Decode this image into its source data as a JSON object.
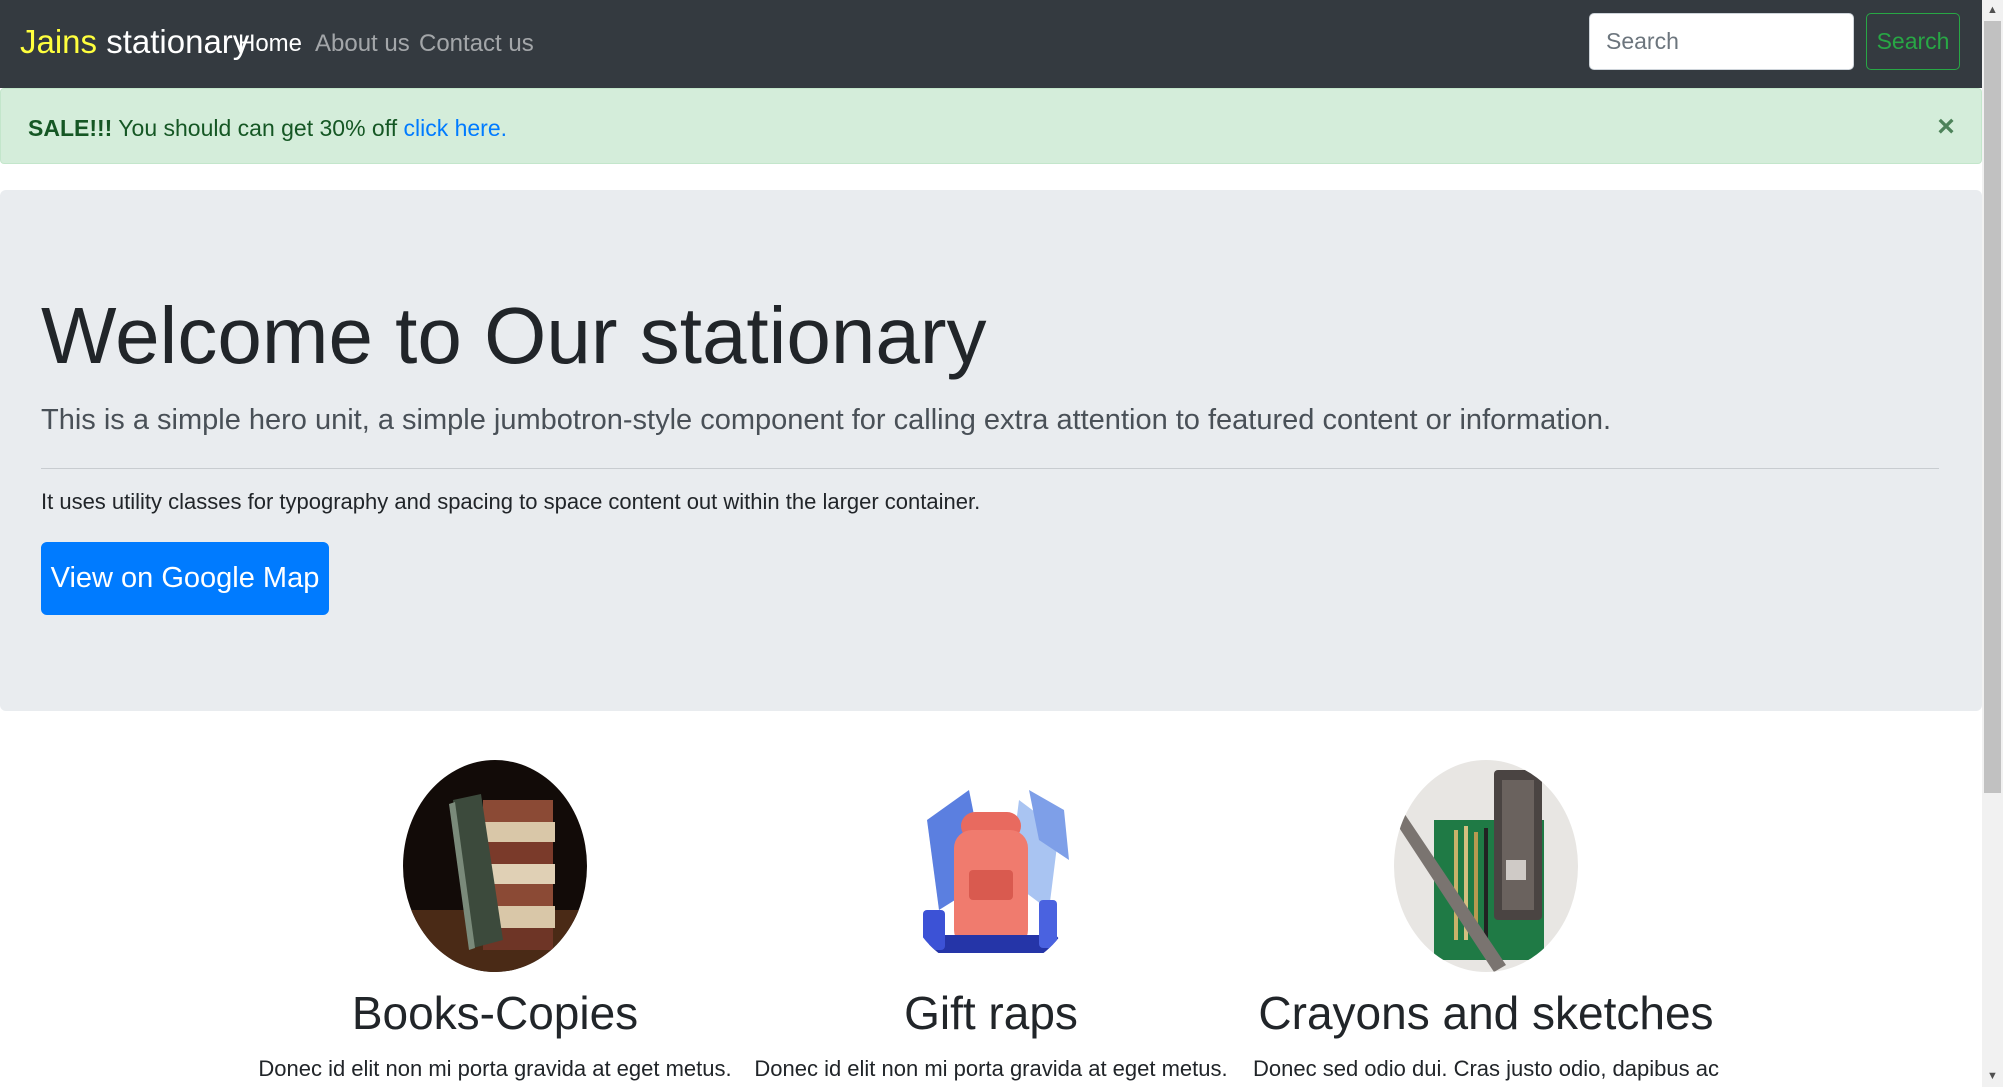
{
  "navbar": {
    "brand_part1": "Jains",
    "brand_part2": " stationary",
    "links": [
      {
        "label": "Home",
        "active": true
      },
      {
        "label": "About us",
        "active": false
      },
      {
        "label": "Contact us",
        "active": false
      }
    ],
    "search_placeholder": "Search",
    "search_button": "Search"
  },
  "alert": {
    "strong": "SALE!!!",
    "text": " You should can get 30% off ",
    "link": "click here.",
    "close": "×"
  },
  "jumbotron": {
    "title": "Welcome to Our stationary",
    "lead": "This is a simple hero unit, a simple jumbotron-style component for calling extra attention to featured content or information.",
    "body": "It uses utility classes for typography and spacing to space content out within the larger container.",
    "button": "View on Google Map"
  },
  "features": [
    {
      "title": "Books-Copies",
      "desc": "Donec id elit non mi porta gravida at eget metus."
    },
    {
      "title": "Gift raps",
      "desc": "Donec id elit non mi porta gravida at eget metus."
    },
    {
      "title": "Crayons and sketches",
      "desc": "Donec sed odio dui. Cras justo odio, dapibus ac"
    }
  ],
  "colors": {
    "navbar_bg": "#343a40",
    "brand_accent": "#ffff3d",
    "alert_bg": "#d4edda",
    "jumbotron_bg": "#e9ecef",
    "primary": "#007bff",
    "success": "#28a745"
  },
  "icons": {
    "close": "close-icon",
    "scroll_up": "scroll-up-arrow",
    "scroll_down": "scroll-down-arrow"
  }
}
